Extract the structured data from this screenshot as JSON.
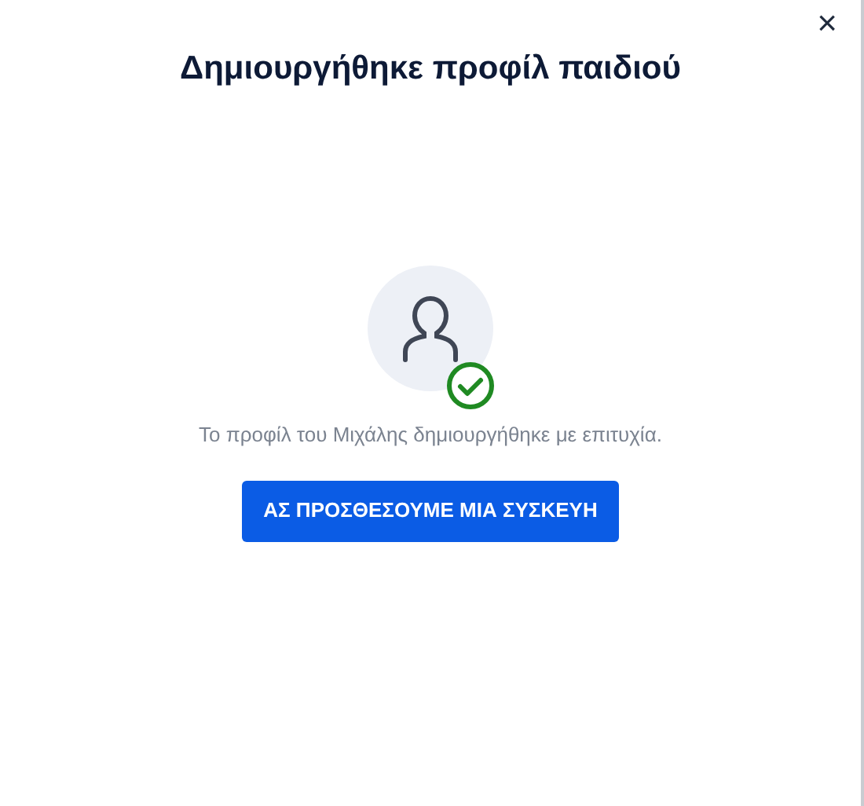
{
  "dialog": {
    "title": "Δημιουργήθηκε προφίλ παιδιού",
    "close": "×",
    "message": "Το προφίλ του Μιχάλης δημιουργήθηκε με επιτυχία.",
    "button": "ΑΣ ΠΡΟΣΘΕΣΟΥΜΕ ΜΙΑ ΣΥΣΚΕΥΗ"
  }
}
